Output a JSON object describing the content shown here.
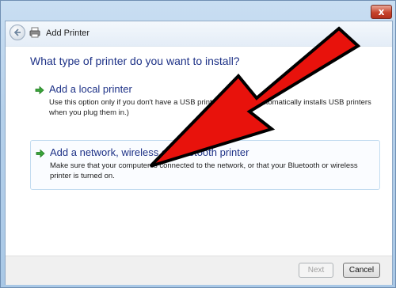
{
  "window": {
    "title": "Add Printer",
    "close_glyph": "x"
  },
  "page": {
    "heading": "What type of printer do you want to install?"
  },
  "options": [
    {
      "title": "Add a local printer",
      "description": "Use this option only if you don't have a USB printer. (Windows automatically installs USB printers when you plug them in.)",
      "icon": "green-arrow-icon"
    },
    {
      "title": "Add a network, wireless or Bluetooth printer",
      "description": "Make sure that your computer is connected to the network, or that your Bluetooth or wireless printer is turned on.",
      "icon": "green-arrow-icon",
      "highlighted": true
    }
  ],
  "buttons": {
    "next": "Next",
    "cancel": "Cancel"
  },
  "colors": {
    "heading": "#1e3287",
    "annotation_arrow": "#e8120c"
  }
}
